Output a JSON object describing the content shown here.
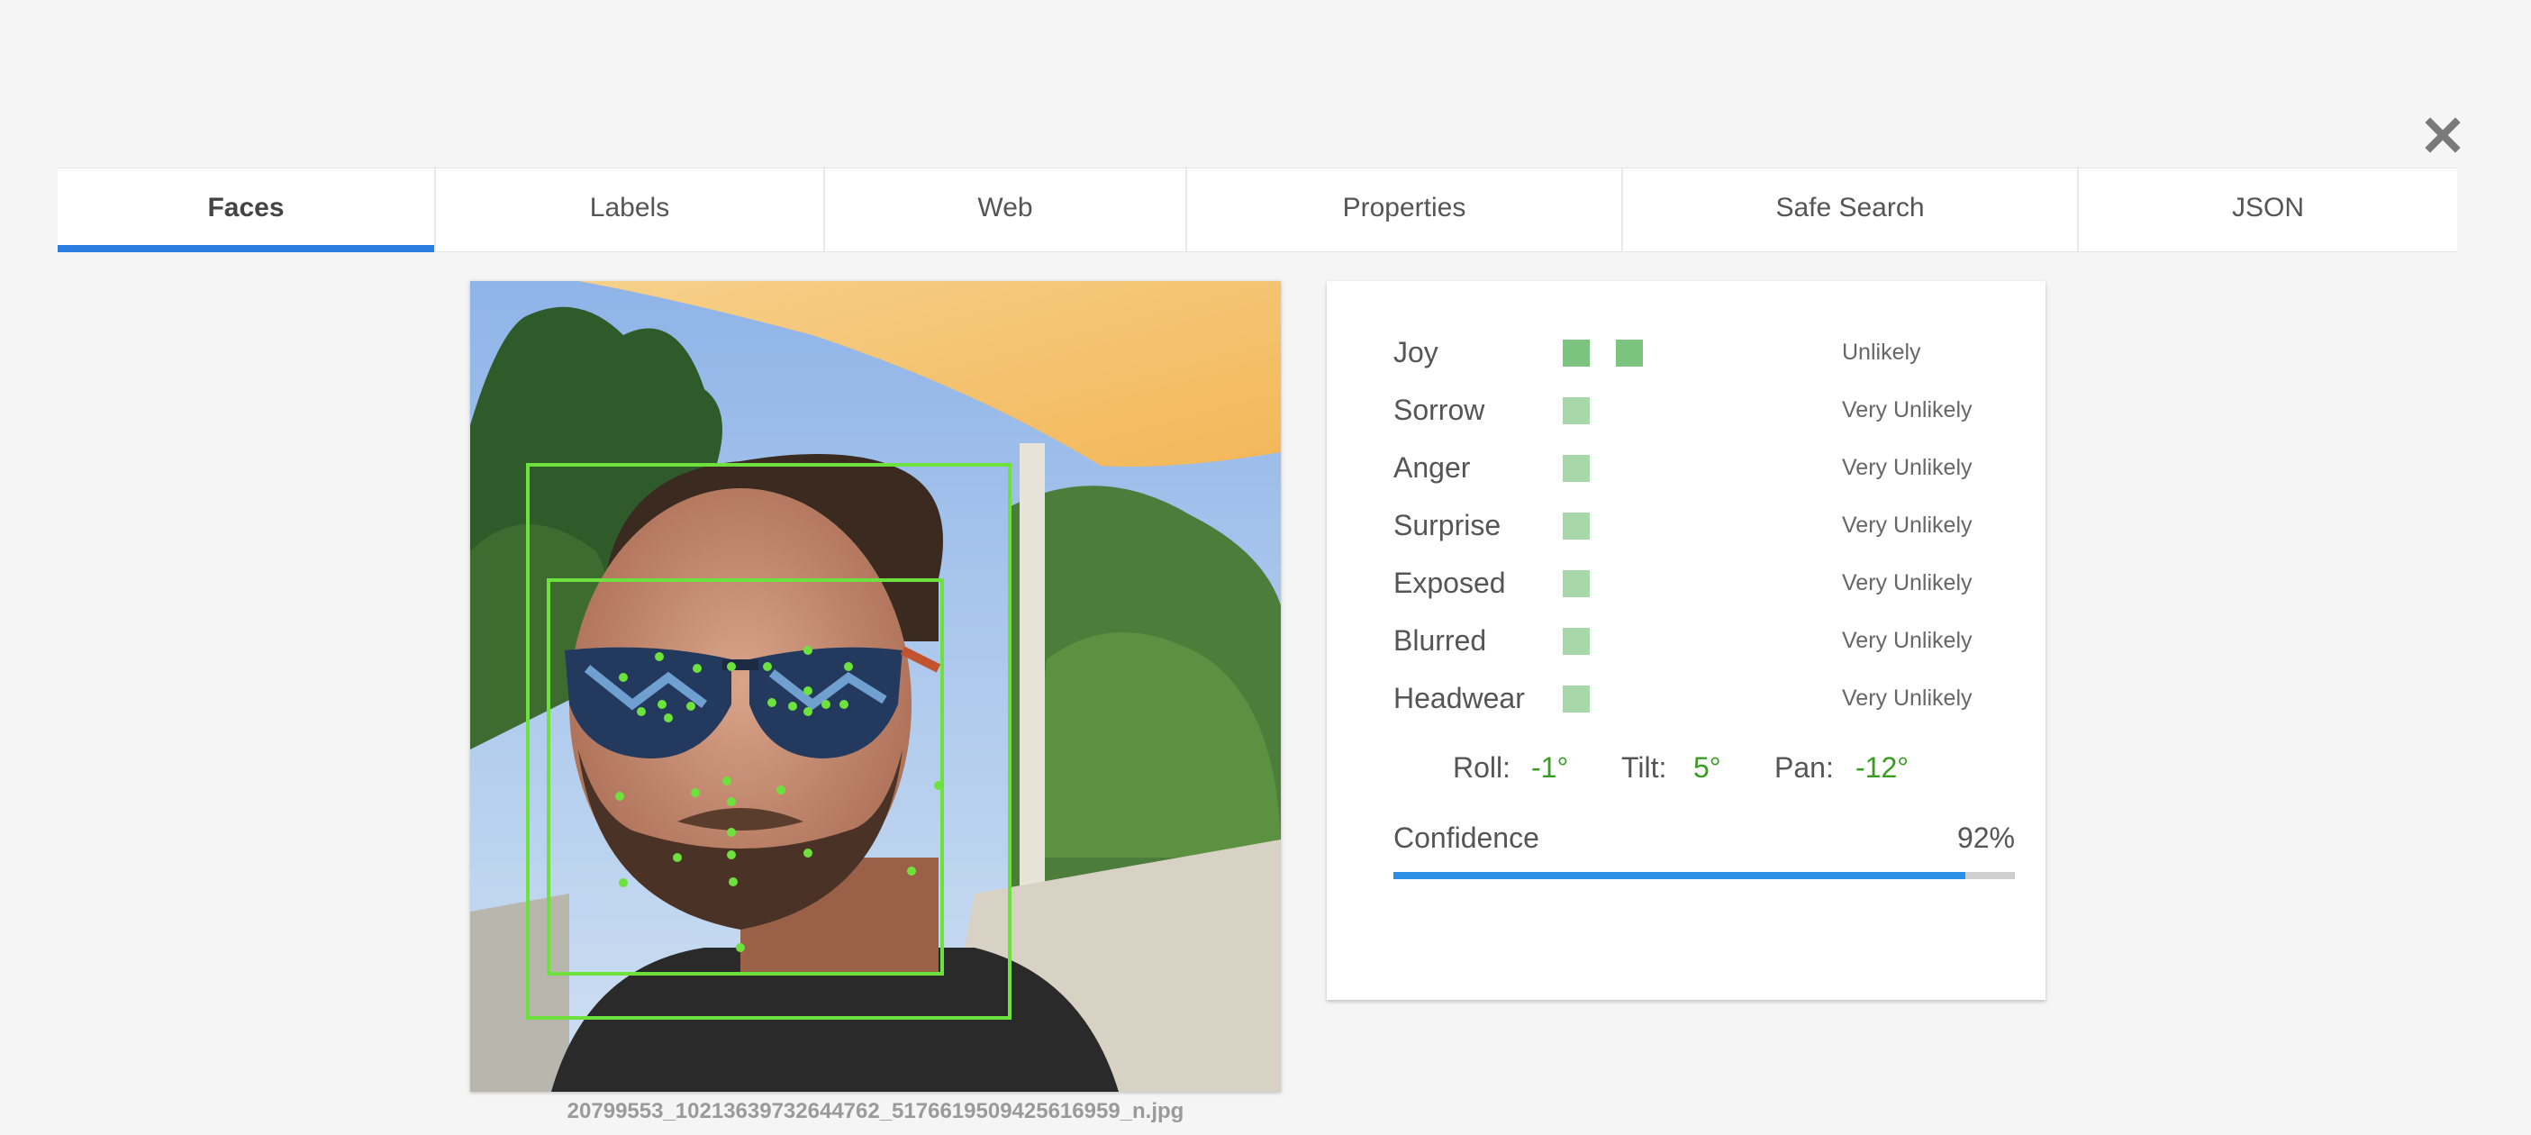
{
  "close_icon": "close-icon",
  "tabs": [
    {
      "label": "Faces",
      "active": true
    },
    {
      "label": "Labels",
      "active": false
    },
    {
      "label": "Web",
      "active": false
    },
    {
      "label": "Properties",
      "active": false
    },
    {
      "label": "Safe Search",
      "active": false
    },
    {
      "label": "JSON",
      "active": false
    }
  ],
  "image": {
    "filename": "20799553_10213639732644762_5176619509425616959_n.jpg"
  },
  "emotions": [
    {
      "name": "Joy",
      "value": "Unlikely",
      "bars": 2
    },
    {
      "name": "Sorrow",
      "value": "Very Unlikely",
      "bars": 1
    },
    {
      "name": "Anger",
      "value": "Very Unlikely",
      "bars": 1
    },
    {
      "name": "Surprise",
      "value": "Very Unlikely",
      "bars": 1
    },
    {
      "name": "Exposed",
      "value": "Very Unlikely",
      "bars": 1
    },
    {
      "name": "Blurred",
      "value": "Very Unlikely",
      "bars": 1
    },
    {
      "name": "Headwear",
      "value": "Very Unlikely",
      "bars": 1
    }
  ],
  "angles": {
    "roll_label": "Roll:",
    "roll": "-1°",
    "tilt_label": "Tilt:",
    "tilt": "5°",
    "pan_label": "Pan:",
    "pan": "-12°"
  },
  "confidence": {
    "label": "Confidence",
    "value": "92%",
    "fraction": 0.92
  },
  "colors": {
    "accent": "#2b7de1",
    "bar_strong": "#7bc47f",
    "bar_light": "#a8d8aa",
    "angle_value": "#3a9d23",
    "face_box": "#6ee23c"
  }
}
